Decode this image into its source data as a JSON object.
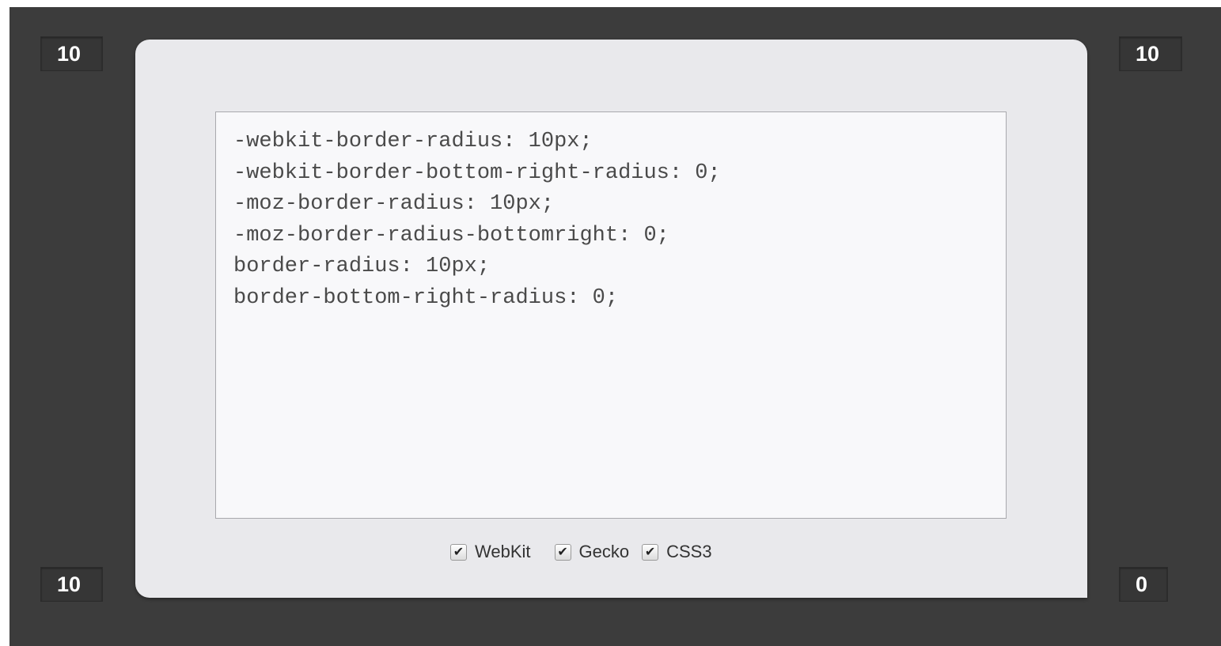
{
  "corners": {
    "top_left": "10",
    "top_right": "10",
    "bottom_left": "10",
    "bottom_right": "0"
  },
  "code_lines": [
    "-webkit-border-radius: 10px;",
    "-webkit-border-bottom-right-radius: 0;",
    "-moz-border-radius: 10px;",
    "-moz-border-radius-bottomright: 0;",
    "border-radius: 10px;",
    "border-bottom-right-radius: 0;"
  ],
  "options": [
    {
      "label": "WebKit",
      "checked": true
    },
    {
      "label": "Gecko",
      "checked": true
    },
    {
      "label": "CSS3",
      "checked": true
    }
  ],
  "colors": {
    "background": "#3c3c3c",
    "preview_box": "#e9e9ec",
    "code_area": "#f8f8fa"
  }
}
